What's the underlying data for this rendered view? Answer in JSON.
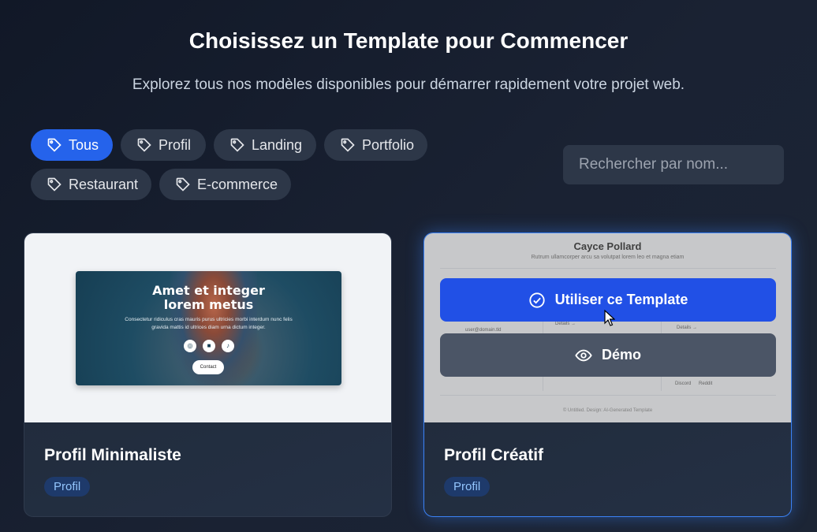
{
  "header": {
    "title": "Choisissez un Template pour Commencer",
    "subtitle": "Explorez tous nos modèles disponibles pour démarrer rapidement votre projet web."
  },
  "filters": [
    {
      "label": "Tous",
      "active": true,
      "icon": "tag-icon"
    },
    {
      "label": "Profil",
      "active": false,
      "icon": "tag-icon"
    },
    {
      "label": "Landing",
      "active": false,
      "icon": "tag-icon"
    },
    {
      "label": "Portfolio",
      "active": false,
      "icon": "tag-icon"
    },
    {
      "label": "Restaurant",
      "active": false,
      "icon": "tag-icon"
    },
    {
      "label": "E-commerce",
      "active": false,
      "icon": "tag-icon"
    }
  ],
  "search": {
    "placeholder": "Rechercher par nom...",
    "value": ""
  },
  "cards": [
    {
      "title": "Profil Minimaliste",
      "category": "Profil",
      "preview": {
        "heading_line1": "Amet et integer",
        "heading_line2": "lorem metus",
        "text": "Consectetur ridiculus cras mauris purus ultricies morbi interdum nunc felis gravida mattis id ultrices diam urna dictum integer.",
        "button": "Contact"
      }
    },
    {
      "title": "Profil Créatif",
      "category": "Profil",
      "preview": {
        "name": "Cayce Pollard",
        "subtitle": "Rutrum ullamcorper arcu sa volutpat lorem leo et magna etiam",
        "email": "user@domain.tld",
        "details_left": "Details →",
        "details_right": "Details →",
        "link1": "Discord",
        "link2": "Reddit",
        "footer": "© Untitled. Design: AI-Generated Template"
      },
      "hover_actions": {
        "use_label": "Utiliser ce Template",
        "demo_label": "Démo"
      }
    }
  ],
  "colors": {
    "accent": "#2563eb",
    "chip_bg": "#2d3748",
    "badge_bg": "#1e3a6b",
    "badge_text": "#93c5fd",
    "demo_button": "#4b5566"
  }
}
